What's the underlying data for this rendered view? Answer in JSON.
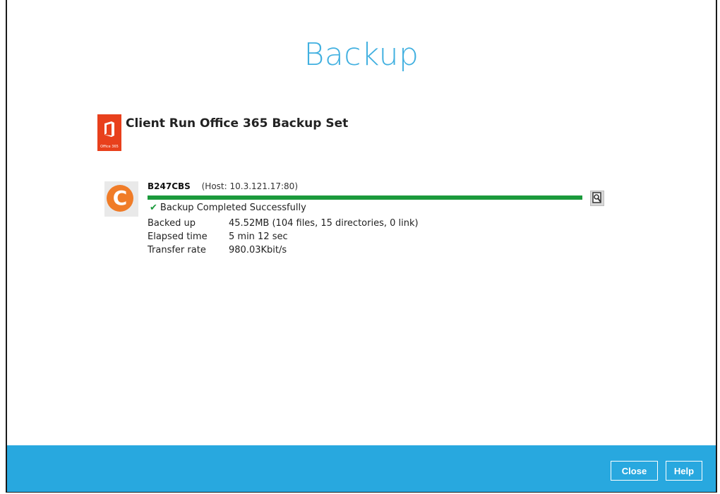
{
  "page": {
    "title": "Backup"
  },
  "backup_set": {
    "name": "Client Run Office 365 Backup Set",
    "icon": "office365-icon",
    "icon_caption": "Office 365"
  },
  "destination": {
    "name": "B247CBS",
    "host": "(Host: 10.3.121.17:80)",
    "icon": "cbs-destination-icon",
    "icon_letter": "C",
    "progress_percent": 100,
    "status": "Backup Completed Successfully",
    "stats": [
      {
        "label": "Backed up",
        "value": "45.52MB (104 files, 15 directories, 0 link)"
      },
      {
        "label": "Elapsed time",
        "value": "5 min 12 sec"
      },
      {
        "label": "Transfer rate",
        "value": "980.03Kbit/s"
      }
    ]
  },
  "footer": {
    "close_label": "Close",
    "help_label": "Help"
  },
  "colors": {
    "accent": "#28a8df",
    "title": "#41b0e0",
    "progress": "#1b9a3c",
    "office": "#e8401c",
    "cbs": "#f07c28"
  }
}
